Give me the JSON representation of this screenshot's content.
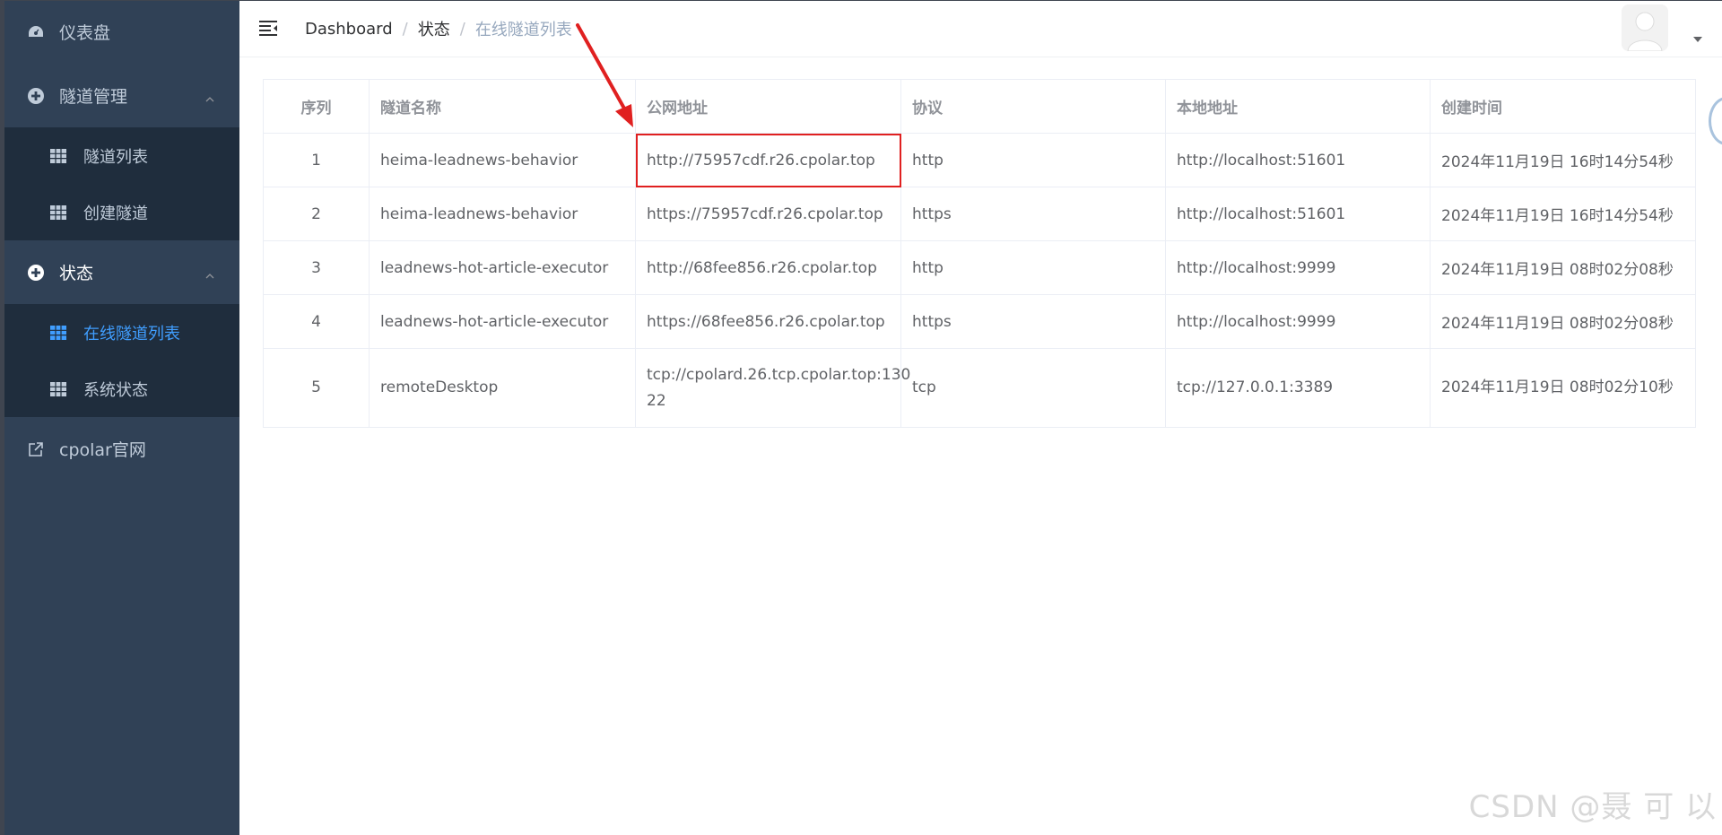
{
  "sidebar": {
    "dashboard": {
      "label": "仪表盘",
      "icon": "dashboard-icon"
    },
    "tunnel_management": {
      "label": "隧道管理",
      "icon": "plus-circle-icon",
      "items": [
        {
          "label": "隧道列表",
          "icon": "grid-icon"
        },
        {
          "label": "创建隧道",
          "icon": "grid-icon"
        }
      ]
    },
    "status": {
      "label": "状态",
      "icon": "plus-circle-icon",
      "items": [
        {
          "label": "在线隧道列表",
          "icon": "grid-icon",
          "active": true
        },
        {
          "label": "系统状态",
          "icon": "grid-icon"
        }
      ]
    },
    "official_site": {
      "label": "cpolar官网",
      "icon": "external-link-icon"
    }
  },
  "header": {
    "breadcrumb": [
      "Dashboard",
      "状态",
      "在线隧道列表"
    ]
  },
  "table": {
    "columns": [
      "序列",
      "隧道名称",
      "公网地址",
      "协议",
      "本地地址",
      "创建时间"
    ],
    "rows": [
      {
        "idx": "1",
        "name": "heima-leadnews-behavior",
        "public_url": "http://75957cdf.r26.cpolar.top",
        "protocol": "http",
        "local": "http://localhost:51601",
        "created": "2024年11月19日 16时14分54秒"
      },
      {
        "idx": "2",
        "name": "heima-leadnews-behavior",
        "public_url": "https://75957cdf.r26.cpolar.top",
        "protocol": "https",
        "local": "http://localhost:51601",
        "created": "2024年11月19日 16时14分54秒"
      },
      {
        "idx": "3",
        "name": "leadnews-hot-article-executor",
        "public_url": "http://68fee856.r26.cpolar.top",
        "protocol": "http",
        "local": "http://localhost:9999",
        "created": "2024年11月19日 08时02分08秒"
      },
      {
        "idx": "4",
        "name": "leadnews-hot-article-executor",
        "public_url": "https://68fee856.r26.cpolar.top",
        "protocol": "https",
        "local": "http://localhost:9999",
        "created": "2024年11月19日 08时02分08秒"
      },
      {
        "idx": "5",
        "name": "remoteDesktop",
        "public_url_line1": "tcp://cpolard.26.tcp.cpolar.top:130",
        "public_url_line2": "22",
        "protocol": "tcp",
        "local": "tcp://127.0.0.1:3389",
        "created": "2024年11月19日 08时02分10秒"
      }
    ]
  },
  "watermark": "CSDN @聂 可 以",
  "colors": {
    "sidebar_bg": "#304156",
    "submenu_bg": "#1f2d3d",
    "active": "#409eff",
    "annotation": "#e02020"
  }
}
